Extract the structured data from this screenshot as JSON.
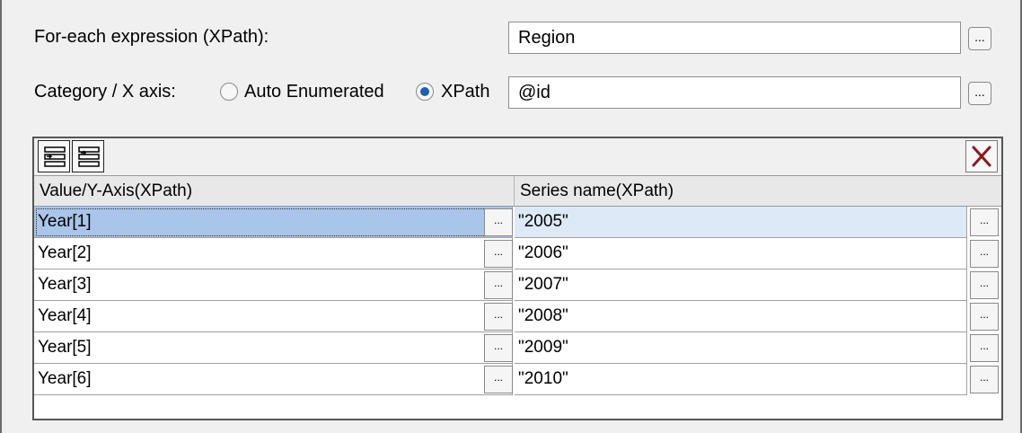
{
  "foreach": {
    "label": "For-each expression (XPath):",
    "value": "Region",
    "button": "..."
  },
  "category": {
    "label": "Category / X axis:",
    "auto_label": "Auto Enumerated",
    "xpath_label": "XPath",
    "selected": "XPath",
    "value": "@id",
    "button": "..."
  },
  "grid": {
    "toolbar": {
      "icons": [
        "insert-row-icon",
        "append-row-icon"
      ],
      "delete_icon": "delete-x-icon",
      "delete_color": "#8b1a1a"
    },
    "columns": [
      "Value/Y-Axis(XPath)",
      "Series name(XPath)"
    ],
    "cell_button": "...",
    "rows": [
      {
        "value": "Year[1]",
        "series": "\"2005\""
      },
      {
        "value": "Year[2]",
        "series": "\"2006\""
      },
      {
        "value": "Year[3]",
        "series": "\"2007\""
      },
      {
        "value": "Year[4]",
        "series": "\"2008\""
      },
      {
        "value": "Year[5]",
        "series": "\"2009\""
      },
      {
        "value": "Year[6]",
        "series": "\"2010\""
      }
    ]
  }
}
